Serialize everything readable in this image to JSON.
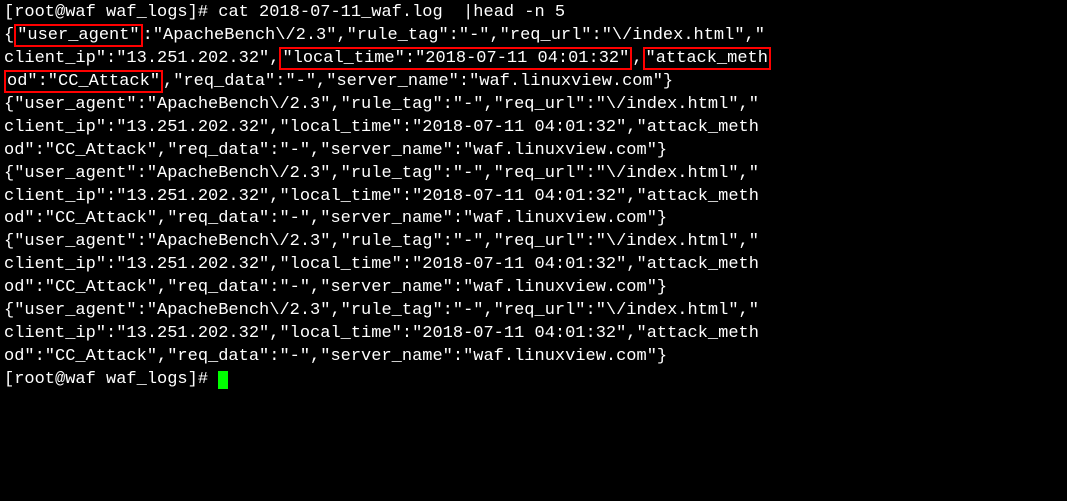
{
  "prompt1": "[root@waf waf_logs]# ",
  "command": "cat 2018-07-11_waf.log  |head -n 5",
  "hl_user_agent": "\"user_agent\"",
  "hl_local_time": "\"local_time\":\"2018-07-11 04:01:32\"",
  "hl_attack1": "\"attack_meth",
  "hl_attack2": "od\":\"CC_Attack\"",
  "l1a": "{",
  "l1b": ":\"ApacheBench\\/2.3\",\"rule_tag\":\"-\",\"req_url\":\"\\/index.html\",\"",
  "l2a": "client_ip\":\"13.251.202.32\",",
  "l2b": ",",
  "l3b": ",\"req_data\":\"-\",\"server_name\":\"waf.linuxview.com\"}",
  "entry_l1": "{\"user_agent\":\"ApacheBench\\/2.3\",\"rule_tag\":\"-\",\"req_url\":\"\\/index.html\",\"",
  "entry_l2": "client_ip\":\"13.251.202.32\",\"local_time\":\"2018-07-11 04:01:32\",\"attack_meth",
  "entry_l3": "od\":\"CC_Attack\",\"req_data\":\"-\",\"server_name\":\"waf.linuxview.com\"}",
  "prompt2": "[root@waf waf_logs]# "
}
